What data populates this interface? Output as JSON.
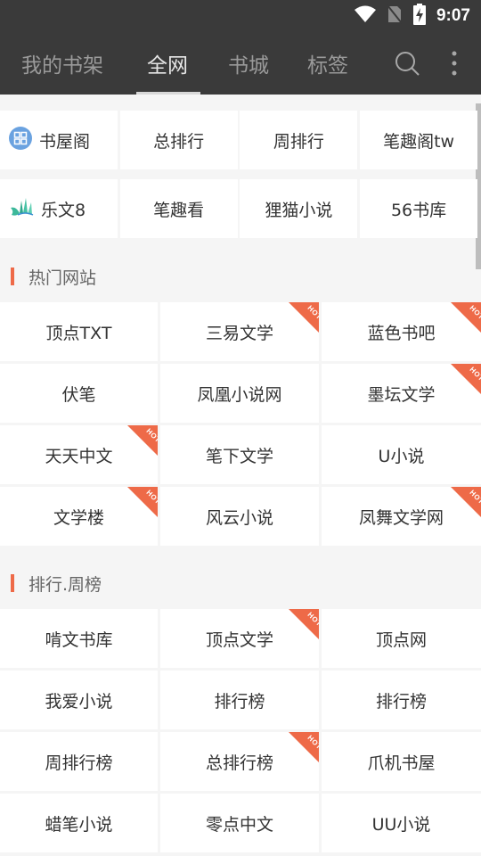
{
  "status_bar": {
    "time": "9:07",
    "icons": [
      "wifi-icon",
      "no-sim-icon",
      "battery-charging-icon"
    ]
  },
  "nav": {
    "tabs": [
      {
        "label": "我的书架",
        "active": false
      },
      {
        "label": "全网",
        "active": true
      },
      {
        "label": "书城",
        "active": false
      },
      {
        "label": "标签",
        "active": false
      }
    ],
    "actions": [
      "search-icon",
      "more-vertical-icon"
    ]
  },
  "quick_links": {
    "rows": [
      [
        {
          "label": "书屋阁",
          "icon": "shuwuge-logo-icon"
        },
        {
          "label": "总排行"
        },
        {
          "label": "周排行"
        },
        {
          "label": "笔趣阁tw"
        }
      ],
      [
        {
          "label": "乐文8",
          "icon": "lewen-logo-icon"
        },
        {
          "label": "笔趣看"
        },
        {
          "label": "狸猫小说"
        },
        {
          "label": "56书库"
        }
      ]
    ]
  },
  "sections": [
    {
      "title": "热门网站",
      "items": [
        {
          "label": "顶点TXT",
          "hot": false
        },
        {
          "label": "三易文学",
          "hot": true
        },
        {
          "label": "蓝色书吧",
          "hot": true
        },
        {
          "label": "伏笔",
          "hot": false
        },
        {
          "label": "凤凰小说网",
          "hot": false
        },
        {
          "label": "墨坛文学",
          "hot": true
        },
        {
          "label": "天天中文",
          "hot": true
        },
        {
          "label": "笔下文学",
          "hot": false
        },
        {
          "label": "U小说",
          "hot": false
        },
        {
          "label": "文学楼",
          "hot": true
        },
        {
          "label": "风云小说",
          "hot": false
        },
        {
          "label": "凤舞文学网",
          "hot": true
        }
      ]
    },
    {
      "title": "排行.周榜",
      "items": [
        {
          "label": "啃文书库",
          "hot": false
        },
        {
          "label": "顶点文学",
          "hot": true
        },
        {
          "label": "顶点网",
          "hot": false
        },
        {
          "label": "我爱小说",
          "hot": false
        },
        {
          "label": "排行榜",
          "hot": false
        },
        {
          "label": "排行榜",
          "hot": false
        },
        {
          "label": "周排行榜",
          "hot": false
        },
        {
          "label": "总排行榜",
          "hot": true
        },
        {
          "label": "爪机书屋",
          "hot": false
        },
        {
          "label": "蜡笔小说",
          "hot": false
        },
        {
          "label": "零点中文",
          "hot": false
        },
        {
          "label": "UU小说",
          "hot": false
        }
      ]
    }
  ],
  "hot_badge_text": "HOT",
  "colors": {
    "topbar": "#3a3a3a",
    "accent": "#ee6a48",
    "background": "#f5f5f5",
    "cell": "#ffffff",
    "text": "#333333"
  }
}
